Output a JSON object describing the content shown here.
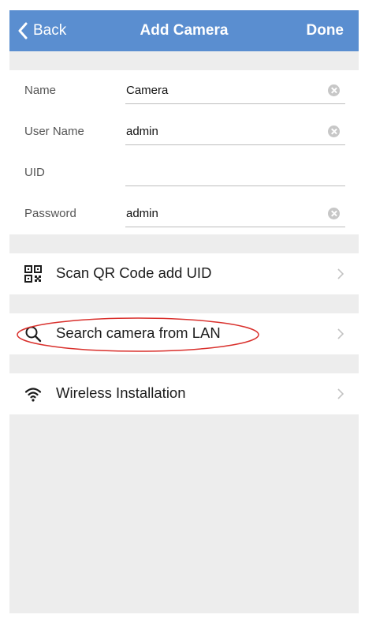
{
  "navbar": {
    "back_label": "Back",
    "title": "Add Camera",
    "done_label": "Done",
    "color": "#5a8ed0"
  },
  "form": {
    "name": {
      "label": "Name",
      "value": "Camera"
    },
    "username": {
      "label": "User Name",
      "value": "admin"
    },
    "uid": {
      "label": "UID",
      "value": ""
    },
    "password": {
      "label": "Password",
      "value": "admin"
    }
  },
  "options": {
    "scan_qr": {
      "label": "Scan QR Code add UID",
      "icon": "qr-code-icon"
    },
    "search_lan": {
      "label": "Search camera from LAN",
      "icon": "search-icon",
      "highlight_color": "#d9302c"
    },
    "wireless": {
      "label": "Wireless Installation",
      "icon": "wifi-icon"
    }
  }
}
